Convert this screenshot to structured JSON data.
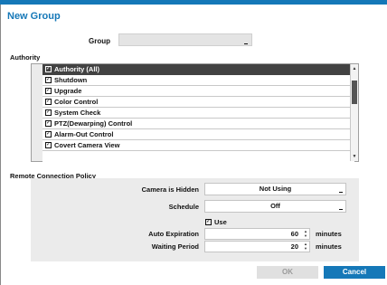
{
  "dialog": {
    "title": "New Group"
  },
  "group": {
    "label": "Group",
    "value": ""
  },
  "authority": {
    "title": "Authority",
    "items": [
      {
        "label": "Authority (All)",
        "checked": true,
        "selected": true
      },
      {
        "label": "Shutdown",
        "checked": true,
        "selected": false
      },
      {
        "label": "Upgrade",
        "checked": true,
        "selected": false
      },
      {
        "label": "Color Control",
        "checked": true,
        "selected": false
      },
      {
        "label": "System Check",
        "checked": true,
        "selected": false
      },
      {
        "label": "PTZ(Dewarping) Control",
        "checked": true,
        "selected": false
      },
      {
        "label": "Alarm-Out Control",
        "checked": true,
        "selected": false
      },
      {
        "label": "Covert Camera View",
        "checked": true,
        "selected": false
      }
    ]
  },
  "remote": {
    "title": "Remote Connection Policy",
    "camera_hidden_label": "Camera is Hidden",
    "camera_hidden_value": "Not Using",
    "schedule_label": "Schedule",
    "schedule_value": "Off",
    "use_label": "Use",
    "use_checked": true,
    "auto_expiration_label": "Auto Expiration",
    "auto_expiration_value": "60",
    "waiting_period_label": "Waiting Period",
    "waiting_period_value": "20",
    "unit": "minutes"
  },
  "buttons": {
    "ok": "OK",
    "cancel": "Cancel"
  },
  "colors": {
    "accent": "#1578b8",
    "selected_row": "#424242",
    "panel": "#ebebeb"
  }
}
